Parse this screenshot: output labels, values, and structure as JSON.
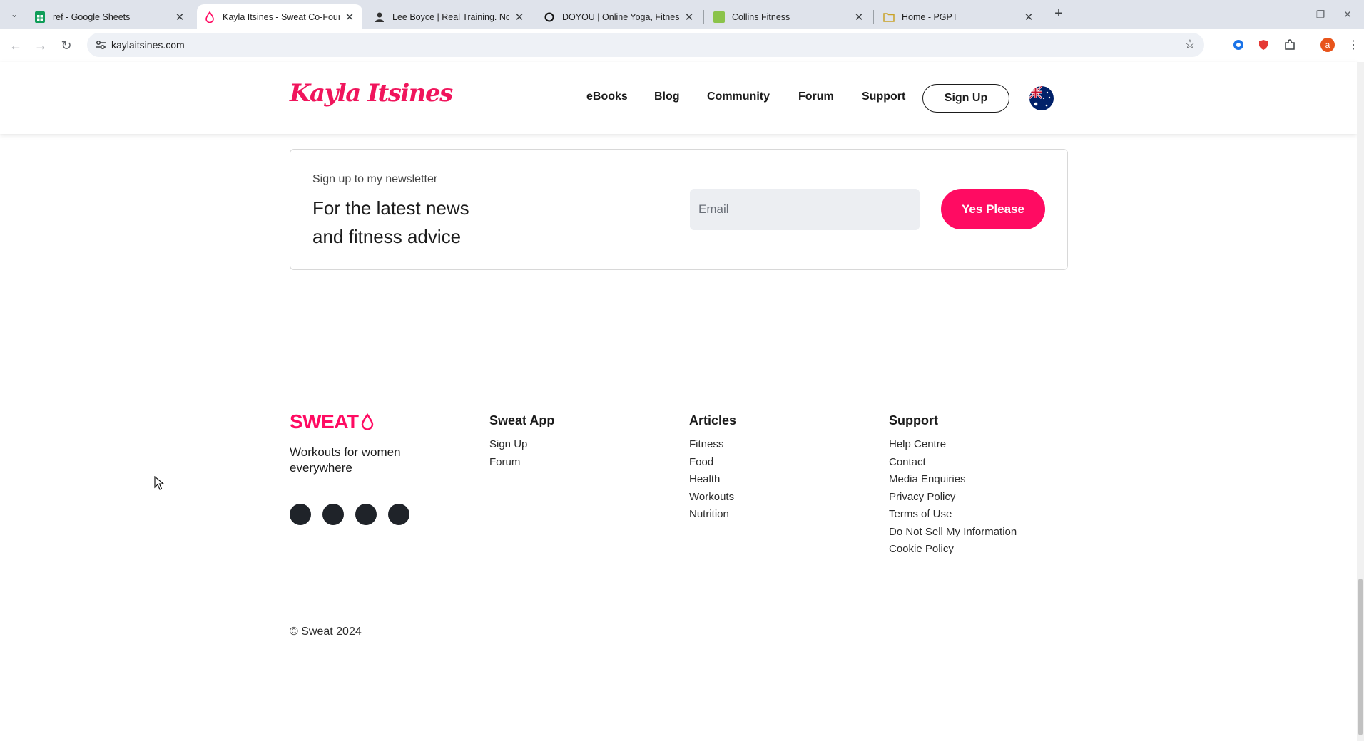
{
  "browser": {
    "tabs": [
      {
        "title": "ref - Google Sheets",
        "icon": "sheets-icon"
      },
      {
        "title": "Kayla Itsines - Sweat Co-Founder",
        "icon": "drop-icon"
      },
      {
        "title": "Lee Boyce | Real Training. No Nonsense",
        "icon": "person-icon"
      },
      {
        "title": "DOYOU | Online Yoga, Fitness, and Wellness",
        "icon": "ring-icon"
      },
      {
        "title": "Collins Fitness",
        "icon": "green-square-icon"
      },
      {
        "title": "Home - PGPT",
        "icon": "folder-icon"
      }
    ],
    "url": "kaylaitsines.com",
    "profile_initial": "a",
    "colors": {
      "tabbar": "#dfe3eb",
      "brand": "#ff0b62"
    }
  },
  "header": {
    "logo_text": "Kayla Itsines",
    "nav": [
      "eBooks",
      "Blog",
      "Community",
      "Forum",
      "Support"
    ],
    "signup_label": "Sign Up",
    "region_icon": "australia-flag-icon"
  },
  "newsletter": {
    "kicker": "Sign up to my newsletter",
    "title": "For the latest news and fitness advice",
    "email_placeholder": "Email",
    "button_label": "Yes Please"
  },
  "footer": {
    "brand": "SWEAT",
    "tagline": "Workouts for women everywhere",
    "social_icons": [
      "instagram-icon",
      "facebook-icon",
      "tiktok-icon",
      "youtube-icon"
    ],
    "columns": [
      {
        "title": "Sweat App",
        "links": [
          "Sign Up",
          "Forum"
        ]
      },
      {
        "title": "Articles",
        "links": [
          "Fitness",
          "Food",
          "Health",
          "Workouts",
          "Nutrition"
        ]
      },
      {
        "title": "Support",
        "links": [
          "Help Centre",
          "Contact",
          "Media Enquiries",
          "Privacy Policy",
          "Terms of Use",
          "Do Not Sell My Information",
          "Cookie Policy"
        ]
      }
    ],
    "copyright": "© Sweat 2024"
  }
}
